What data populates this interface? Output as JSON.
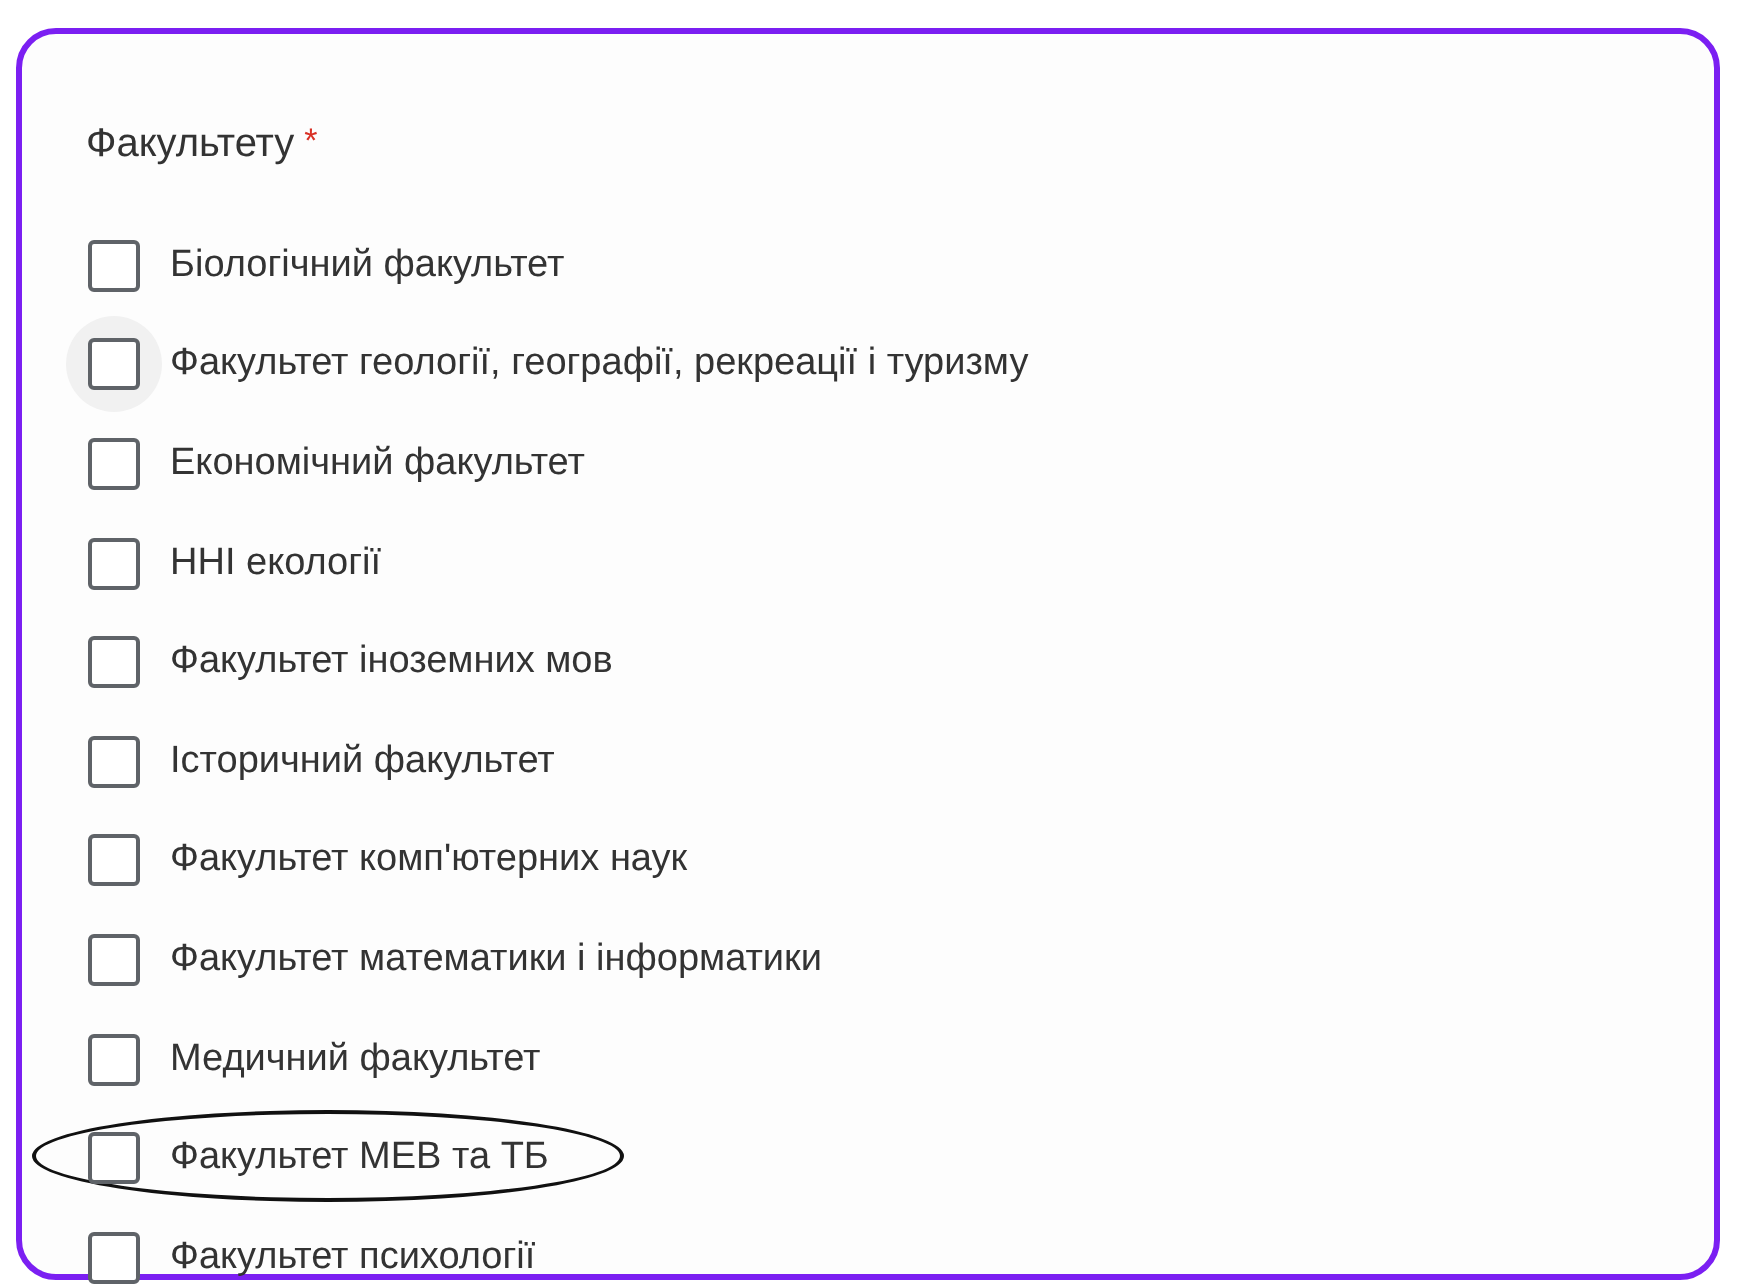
{
  "question": {
    "title": "Факультету",
    "required_mark": "*"
  },
  "options": [
    {
      "label": "Біологічний факультет",
      "checked": false,
      "hovered": false,
      "circled": false
    },
    {
      "label": "Факультет геології, географії, рекреації і туризму",
      "checked": false,
      "hovered": true,
      "circled": false
    },
    {
      "label": "Економічний факультет",
      "checked": false,
      "hovered": false,
      "circled": false
    },
    {
      "label": "ННІ екології",
      "checked": false,
      "hovered": false,
      "circled": false
    },
    {
      "label": "Факультет іноземних мов",
      "checked": false,
      "hovered": false,
      "circled": false
    },
    {
      "label": "Історичний факультет",
      "checked": false,
      "hovered": false,
      "circled": false
    },
    {
      "label": "Факультет комп'ютерних наук",
      "checked": false,
      "hovered": false,
      "circled": false
    },
    {
      "label": "Факультет математики і інформатики",
      "checked": false,
      "hovered": false,
      "circled": false
    },
    {
      "label": "Медичний факультет",
      "checked": false,
      "hovered": false,
      "circled": false
    },
    {
      "label": "Факультет МЕВ та ТБ",
      "checked": false,
      "hovered": false,
      "circled": true
    },
    {
      "label": "Факультет психології",
      "checked": false,
      "hovered": false,
      "circled": false
    }
  ]
}
